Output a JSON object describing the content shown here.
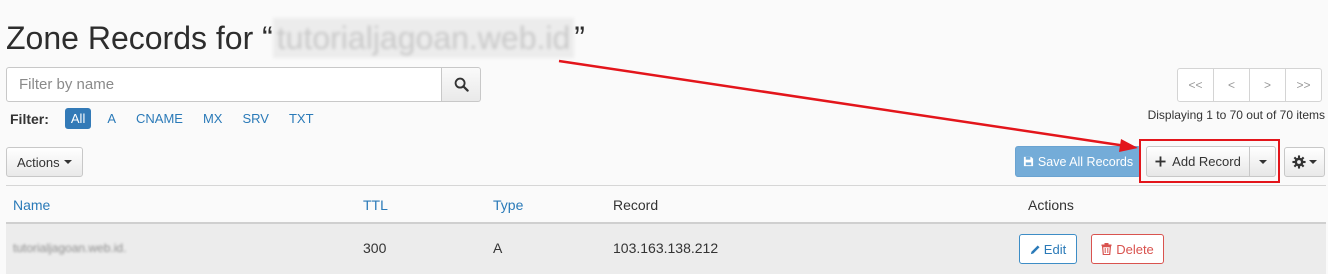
{
  "header": {
    "title_prefix": "Zone Records for “",
    "domain": "tutorialjagoan.web.id",
    "title_suffix": "”"
  },
  "search": {
    "placeholder": "Filter by name",
    "value": "",
    "icon": "search-icon"
  },
  "filter": {
    "label": "Filter:",
    "options": [
      "All",
      "A",
      "CNAME",
      "MX",
      "SRV",
      "TXT"
    ],
    "active": "All"
  },
  "pagination": {
    "first": "<<",
    "prev": "<",
    "next": ">",
    "last": ">>",
    "status": "Displaying 1 to 70 out of 70 items"
  },
  "toolbar": {
    "actions_label": "Actions",
    "save_label": "Save All Records",
    "add_label": "Add Record",
    "settings_icon": "gear-icon"
  },
  "table": {
    "columns": [
      "Name",
      "TTL",
      "Type",
      "Record",
      "Actions"
    ],
    "rows": [
      {
        "name": "tutorialjagoan.web.id.",
        "ttl": "300",
        "type": "A",
        "record": "103.163.138.212",
        "edit_label": "Edit",
        "delete_label": "Delete"
      }
    ]
  },
  "colors": {
    "primary": "#337ab7",
    "link": "#2a7ab8",
    "danger": "#d9534f",
    "save_button": "#74acd8",
    "annotation": "#e3151b"
  }
}
